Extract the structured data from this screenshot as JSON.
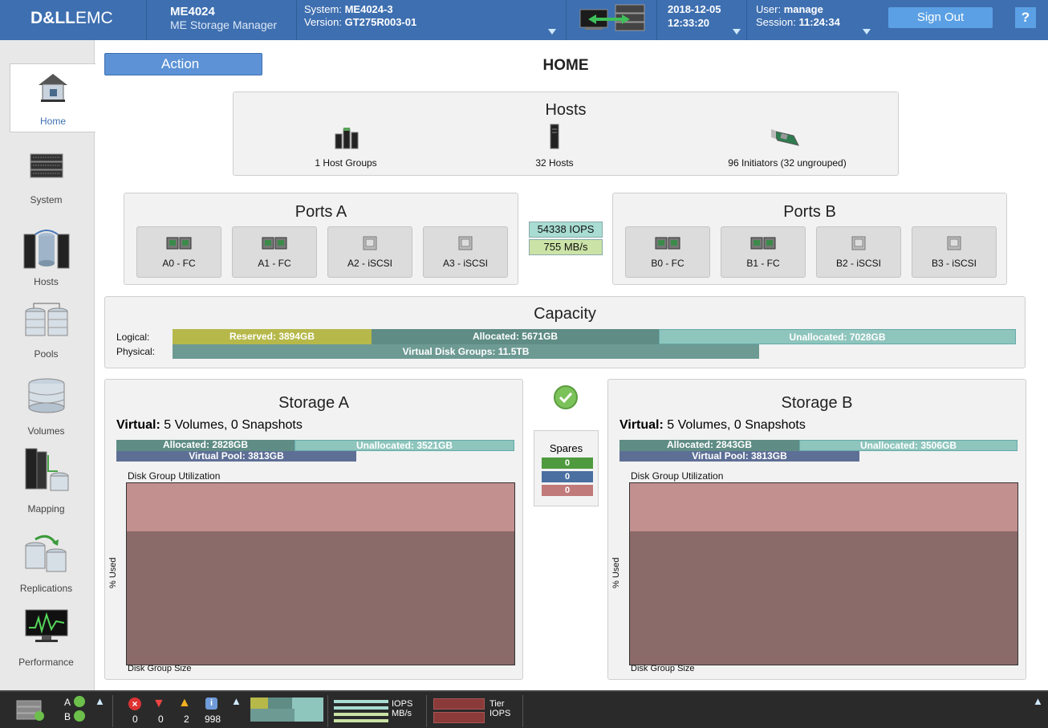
{
  "brand": {
    "dell": "D&LL",
    "emc": "EMC"
  },
  "header": {
    "product_model": "ME4024",
    "product_name": "ME Storage Manager",
    "system_label": "System:",
    "system_name": "ME4024-3",
    "version_label": "Version:",
    "version": "GT275R003-01",
    "date": "2018-12-05",
    "time": "12:33:20",
    "user_label": "User:",
    "user": "manage",
    "session_label": "Session:",
    "session": "11:24:34",
    "sign_out": "Sign Out",
    "help": "?"
  },
  "sidebar": {
    "items": [
      {
        "label": "Home",
        "icon": "home-icon"
      },
      {
        "label": "System",
        "icon": "system-icon"
      },
      {
        "label": "Hosts",
        "icon": "hosts-icon"
      },
      {
        "label": "Pools",
        "icon": "pools-icon"
      },
      {
        "label": "Volumes",
        "icon": "volumes-icon"
      },
      {
        "label": "Mapping",
        "icon": "mapping-icon"
      },
      {
        "label": "Replications",
        "icon": "replications-icon"
      },
      {
        "label": "Performance",
        "icon": "performance-icon"
      }
    ]
  },
  "main": {
    "action": "Action",
    "title": "HOME",
    "hosts": {
      "title": "Hosts",
      "host_groups": "1 Host Groups",
      "hosts": "32 Hosts",
      "initiators": "96 Initiators (32 ungrouped)"
    },
    "ports_a": {
      "title": "Ports A",
      "ports": [
        "A0 - FC",
        "A1 - FC",
        "A2 - iSCSI",
        "A3 - iSCSI"
      ]
    },
    "ports_b": {
      "title": "Ports B",
      "ports": [
        "B0 - FC",
        "B1 - FC",
        "B2 - iSCSI",
        "B3 - iSCSI"
      ]
    },
    "perf": {
      "iops": "54338 IOPS",
      "mbs": "755 MB/s"
    },
    "capacity": {
      "title": "Capacity",
      "logical_label": "Logical:",
      "physical_label": "Physical:",
      "reserved": "Reserved: 3894GB",
      "allocated": "Allocated: 5671GB",
      "unallocated": "Unallocated: 7028GB",
      "vdg": "Virtual Disk Groups: 11.5TB",
      "logical_values_gb": {
        "reserved": 3894,
        "allocated": 5671,
        "unallocated": 7028
      }
    },
    "storage_a": {
      "title": "Storage A",
      "virtual_label": "Virtual:",
      "virtual_text": "5 Volumes, 0 Snapshots",
      "allocated": "Allocated: 2828GB",
      "unallocated": "Unallocated: 3521GB",
      "pool": "Virtual Pool: 3813GB",
      "util_label": "Disk Group Utilization",
      "y_label": "% Used",
      "x_label": "Disk Group Size"
    },
    "storage_b": {
      "title": "Storage B",
      "virtual_label": "Virtual:",
      "virtual_text": "5 Volumes, 0 Snapshots",
      "allocated": "Allocated: 2843GB",
      "unallocated": "Unallocated: 3506GB",
      "pool": "Virtual Pool: 3813GB",
      "util_label": "Disk Group Utilization",
      "y_label": "% Used",
      "x_label": "Disk Group Size"
    },
    "spares": {
      "title": "Spares",
      "values": [
        "0",
        "0",
        "0"
      ]
    }
  },
  "footer": {
    "controller_a": "A",
    "controller_b": "B",
    "errors": "0",
    "warnings_critical": "0",
    "warnings": "2",
    "info": "998",
    "iops_label": "IOPS",
    "mbs_label": "MB/s",
    "tier_label": "Tier",
    "tier_iops_label": "IOPS"
  },
  "colors": {
    "header": "#3e6fb0",
    "reserved": "#b6b84a",
    "allocated": "#5f8c85",
    "unallocated": "#8ec5bd",
    "pool": "#5e6f96",
    "chart_top": "#c2908f",
    "chart_body": "#8b6a6a"
  }
}
